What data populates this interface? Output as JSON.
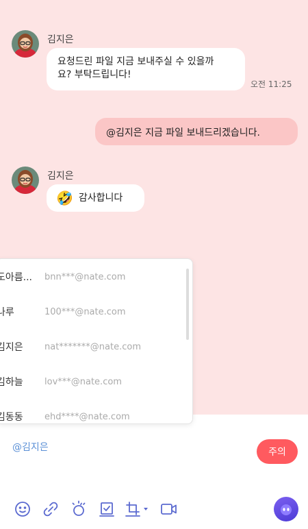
{
  "messages": [
    {
      "sender": "김지은",
      "lines": [
        "요청드린 파일 지금 보내주실 수 있을까",
        "요? 부탁드립니다!"
      ],
      "time": "오전 11:25"
    },
    {
      "mine": true,
      "text": "@김지은 지금 파일 보내드리겠습니다."
    },
    {
      "sender": "김지은",
      "emoji": "🤣",
      "text": "감사합니다"
    }
  ],
  "mention_list": [
    {
      "name": "도아름...",
      "email": "bnn***@nate.com"
    },
    {
      "name": "나루",
      "email": "100***@nate.com"
    },
    {
      "name": "김지은",
      "email": "nat*******@nate.com"
    },
    {
      "name": "김하늘",
      "email": "lov***@nate.com"
    },
    {
      "name": "김동동",
      "email": "ehd****@nate.com"
    }
  ],
  "composer": {
    "value": "@김지은",
    "notice_button": "주의"
  },
  "toolbar": {
    "icons": [
      "emoji-icon",
      "attach-icon",
      "sparkle-icon",
      "checklist-icon",
      "crop-icon",
      "video-icon"
    ]
  },
  "colors": {
    "chat_background": "#fde4e4",
    "my_bubble": "#fbc6c6",
    "accent_red": "#ff5a5f",
    "mention_blue": "#5a8fd6",
    "bot_purple": "#5a44e0"
  }
}
